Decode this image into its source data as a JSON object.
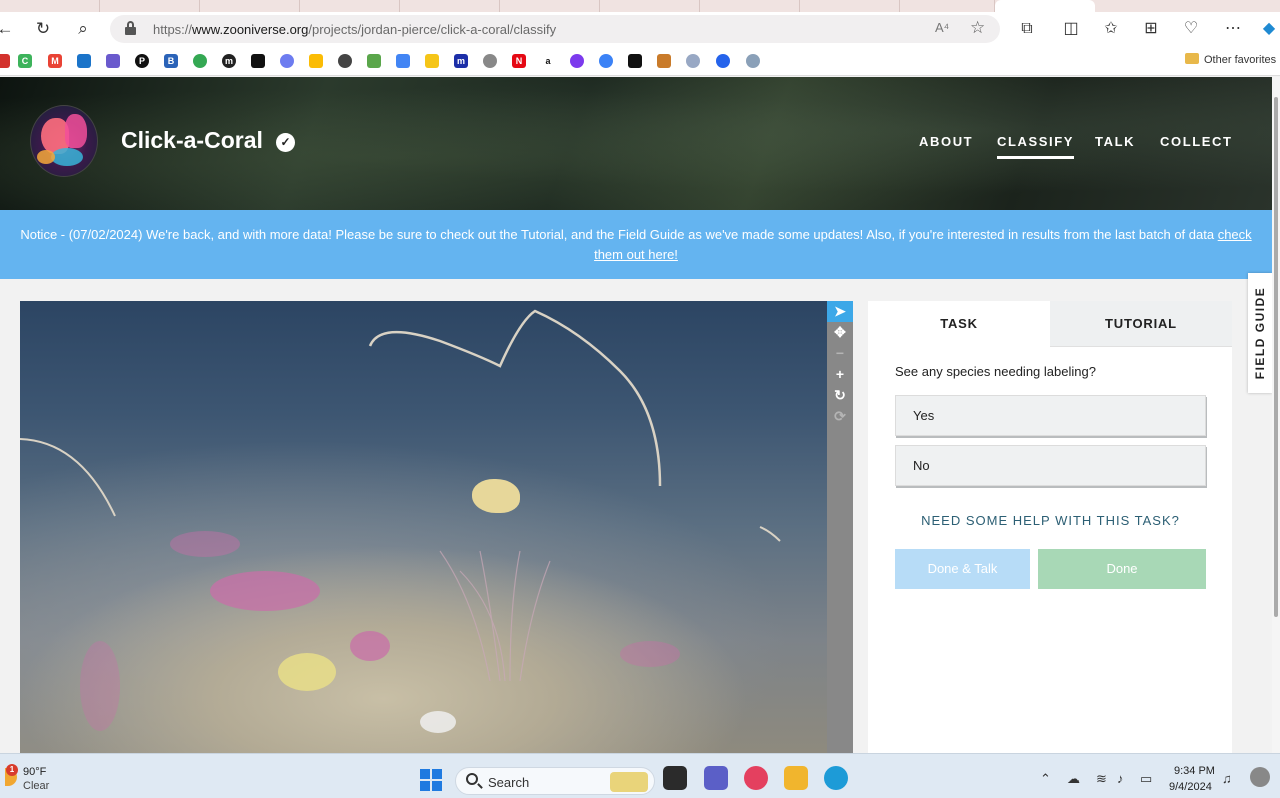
{
  "browser": {
    "url_proto": "https://",
    "url_host": "www.zooniverse.org",
    "url_path": "/projects/jordan-pierce/click-a-coral/classify",
    "read_aloud_label": "A⁴",
    "other_favorites": "Other favorites",
    "bookmark_letters": [
      "C",
      "M",
      "",
      "",
      "P",
      "B",
      "",
      "m",
      "",
      "",
      "",
      "",
      "",
      "",
      "",
      "m",
      "",
      "N",
      "a",
      "",
      "",
      "",
      "",
      "",
      "",
      ""
    ]
  },
  "project": {
    "title": "Click-a-Coral",
    "nav": [
      {
        "label": "ABOUT"
      },
      {
        "label": "CLASSIFY"
      },
      {
        "label": "TALK"
      },
      {
        "label": "COLLECT"
      }
    ]
  },
  "notice": {
    "text": "Notice - (07/02/2024) We're back, and with more data! Please be sure to check out the Tutorial, and the Field Guide as we've made some updates! Also, if you're interested in results from the last batch of data ",
    "link": "check them out here!"
  },
  "task_panel": {
    "tabs": [
      {
        "label": "TASK"
      },
      {
        "label": "TUTORIAL"
      }
    ],
    "question": "See any species needing labeling?",
    "answers": [
      {
        "label": "Yes"
      },
      {
        "label": "No"
      }
    ],
    "help": "NEED SOME HELP WITH THIS TASK?",
    "done_talk": "Done & Talk",
    "done": "Done"
  },
  "field_guide": "FIELD GUIDE",
  "taskbar": {
    "weather_badge": "1",
    "temperature": "90°F",
    "condition": "Clear",
    "search": "Search",
    "time": "9:34 PM",
    "date": "9/4/2024"
  },
  "colors": {
    "notice_bg": "#64b4f0",
    "done_talk_bg": "#b7dcf7",
    "done_bg": "#a8d8b6",
    "help_text": "#2c5f74",
    "active_tool": "#3da8e8"
  }
}
